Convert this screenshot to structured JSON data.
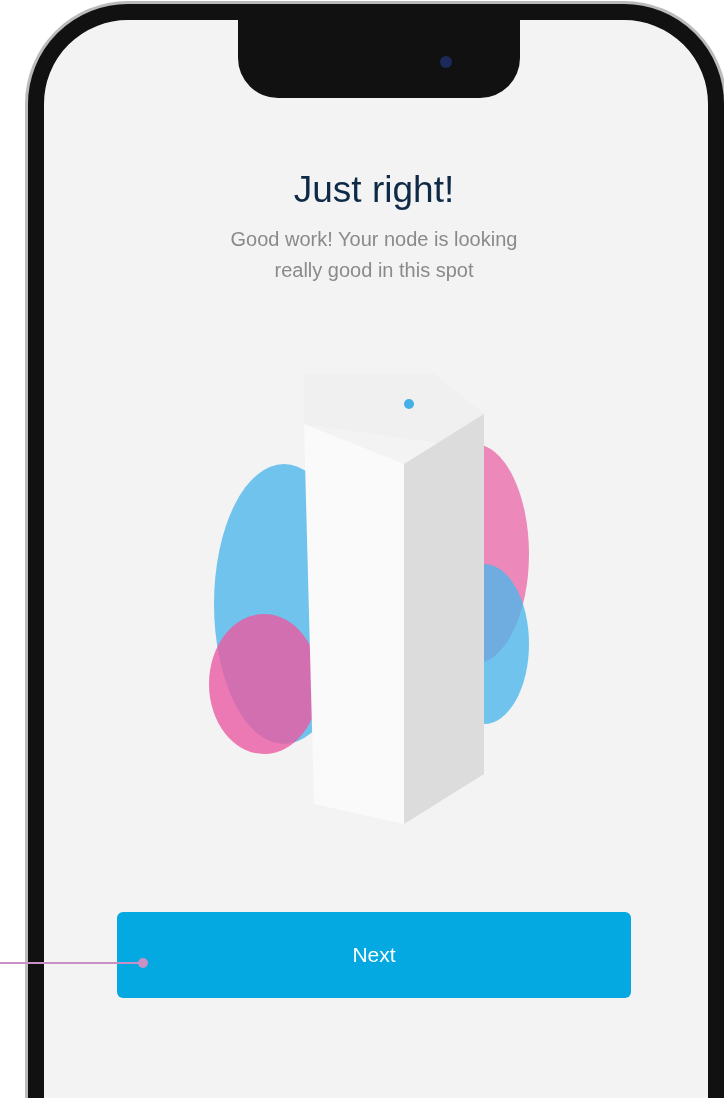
{
  "screen": {
    "title": "Just right!",
    "message": "Good work! Your node is looking really good in this spot",
    "next_button": "Next"
  }
}
